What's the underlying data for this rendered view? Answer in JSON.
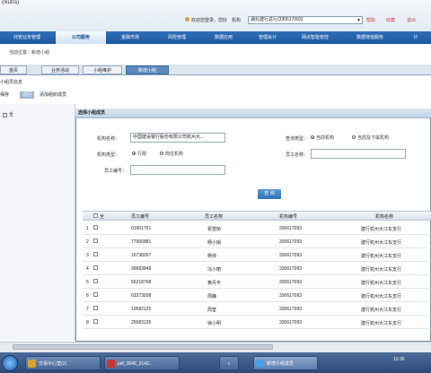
{
  "app": {
    "brand": "(Ikutra)",
    "user_text": "欢迎您登录，您好",
    "org_value": "湖北建行总行(330617093)",
    "toplinks": [
      "帮助",
      "收藏",
      "退出"
    ]
  },
  "nav": [
    {
      "label": "托管业务管理",
      "active": false
    },
    {
      "label": "公司服务",
      "active": true
    },
    {
      "label": "金融市场",
      "active": false
    },
    {
      "label": "风险管理",
      "active": false
    },
    {
      "label": "数据应用",
      "active": false
    },
    {
      "label": "管理会计",
      "active": false
    },
    {
      "label": "网点智能管控",
      "active": false
    },
    {
      "label": "数据增值服务",
      "active": false
    },
    {
      "label": "计",
      "active": false
    }
  ],
  "breadcrumb": "当前位置：新增小组",
  "tabs": [
    {
      "label": "首页",
      "active": false
    },
    {
      "label": "业务活动",
      "active": false
    },
    {
      "label": "小组维护",
      "active": false
    },
    {
      "label": "新增小组",
      "active": true
    }
  ],
  "section_title": "小组员信息",
  "subbar": [
    "保存",
    "返回",
    "添加组织成员"
  ],
  "left_col_label": "全",
  "dialog": {
    "title": "选择小组成员",
    "fields": {
      "org_name_label": "机构名称：",
      "org_name_value": "中国建设银行股份有限公司杭州大...",
      "org_type_label": "机构类型：",
      "org_type_options": [
        "行政",
        "岗位机构"
      ],
      "staff_no_label": "员工编号：",
      "query_type_label": "查询类型：",
      "query_type_options": [
        "当前机构",
        "当前及下属机构"
      ],
      "staff_name_label": "员工名称："
    },
    "query_button": "查 询",
    "columns": [
      "全",
      "员工编号",
      "员工名称",
      "机构编号",
      "机构名称"
    ],
    "rows": [
      {
        "n": "1",
        "id": "01901751",
        "name": "祝雪娇",
        "org": "330617093",
        "orgname": "建行杭州大江东支行"
      },
      {
        "n": "2",
        "id": "77965881",
        "name": "杨小娟",
        "org": "330617093",
        "orgname": "建行杭州大江东支行"
      },
      {
        "n": "3",
        "id": "16738267",
        "name": "杨帅",
        "org": "330617093",
        "orgname": "建行杭州大江东支行"
      },
      {
        "n": "4",
        "id": "39683849",
        "name": "冯小丽",
        "org": "330617093",
        "orgname": "建行杭州大江东支行"
      },
      {
        "n": "5",
        "id": "56218768",
        "name": "黄丹平",
        "org": "330617093",
        "orgname": "建行杭州大江东支行"
      },
      {
        "n": "6",
        "id": "63373938",
        "name": "周静",
        "org": "330617093",
        "orgname": "建行杭州大江东支行"
      },
      {
        "n": "7",
        "id": "10582125",
        "name": "周莹",
        "org": "330617093",
        "orgname": "建行杭州大江东支行"
      },
      {
        "n": "8",
        "id": "25583136",
        "name": "徐小明",
        "org": "330617093",
        "orgname": "建行杭州大江东支行"
      }
    ]
  },
  "taskbar": [
    {
      "label": "交易中心营(2)",
      "active": false
    },
    {
      "label": "pdf_3045_2143...",
      "active": false
    },
    {
      "label": "e",
      "active": false
    },
    {
      "label": "新增小组成员",
      "active": true
    }
  ],
  "clock": "10:35",
  "colors": {
    "nav": "#1d58a0",
    "accent": "#2f70b4",
    "taskbar": "#2b4a78"
  }
}
